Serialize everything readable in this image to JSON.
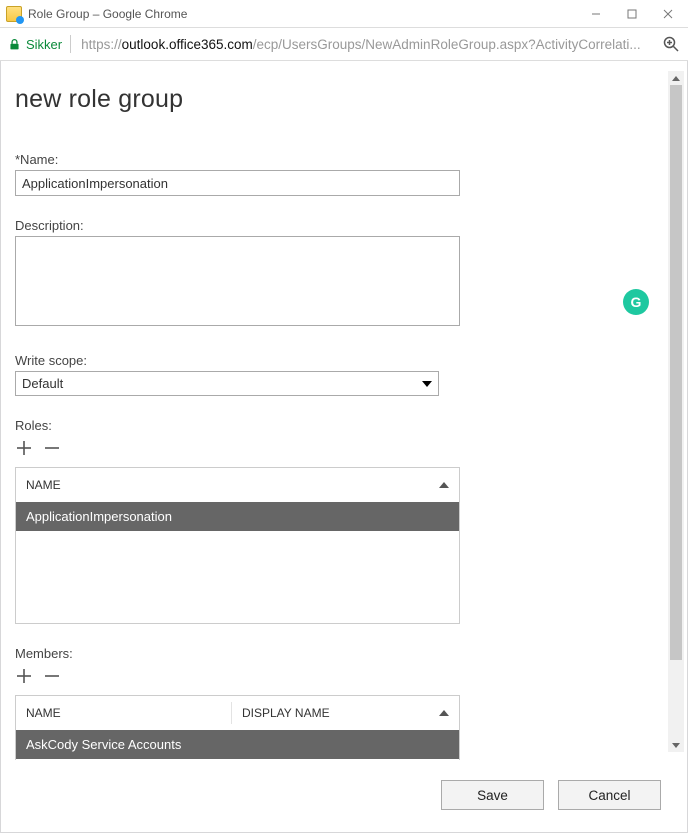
{
  "window": {
    "title": "Role Group – Google Chrome"
  },
  "address": {
    "secure_label": "Sikker",
    "url_prefix": "https://",
    "url_host": "outlook.office365.com",
    "url_path": "/ecp/UsersGroups/NewAdminRoleGroup.aspx?ActivityCorrelati..."
  },
  "page": {
    "title": "new role group",
    "name_label": "*Name:",
    "name_value": "ApplicationImpersonation",
    "description_label": "Description:",
    "description_value": "",
    "scope_label": "Write scope:",
    "scope_value": "Default"
  },
  "roles": {
    "label": "Roles:",
    "col_name": "NAME",
    "items": [
      {
        "name": "ApplicationImpersonation"
      }
    ]
  },
  "members": {
    "label": "Members:",
    "col_name": "NAME",
    "col_display": "DISPLAY NAME",
    "items": [
      {
        "name": "AskCody Service Accounts",
        "display": ""
      }
    ]
  },
  "footer": {
    "save": "Save",
    "cancel": "Cancel"
  },
  "badge": {
    "letter": "G"
  }
}
